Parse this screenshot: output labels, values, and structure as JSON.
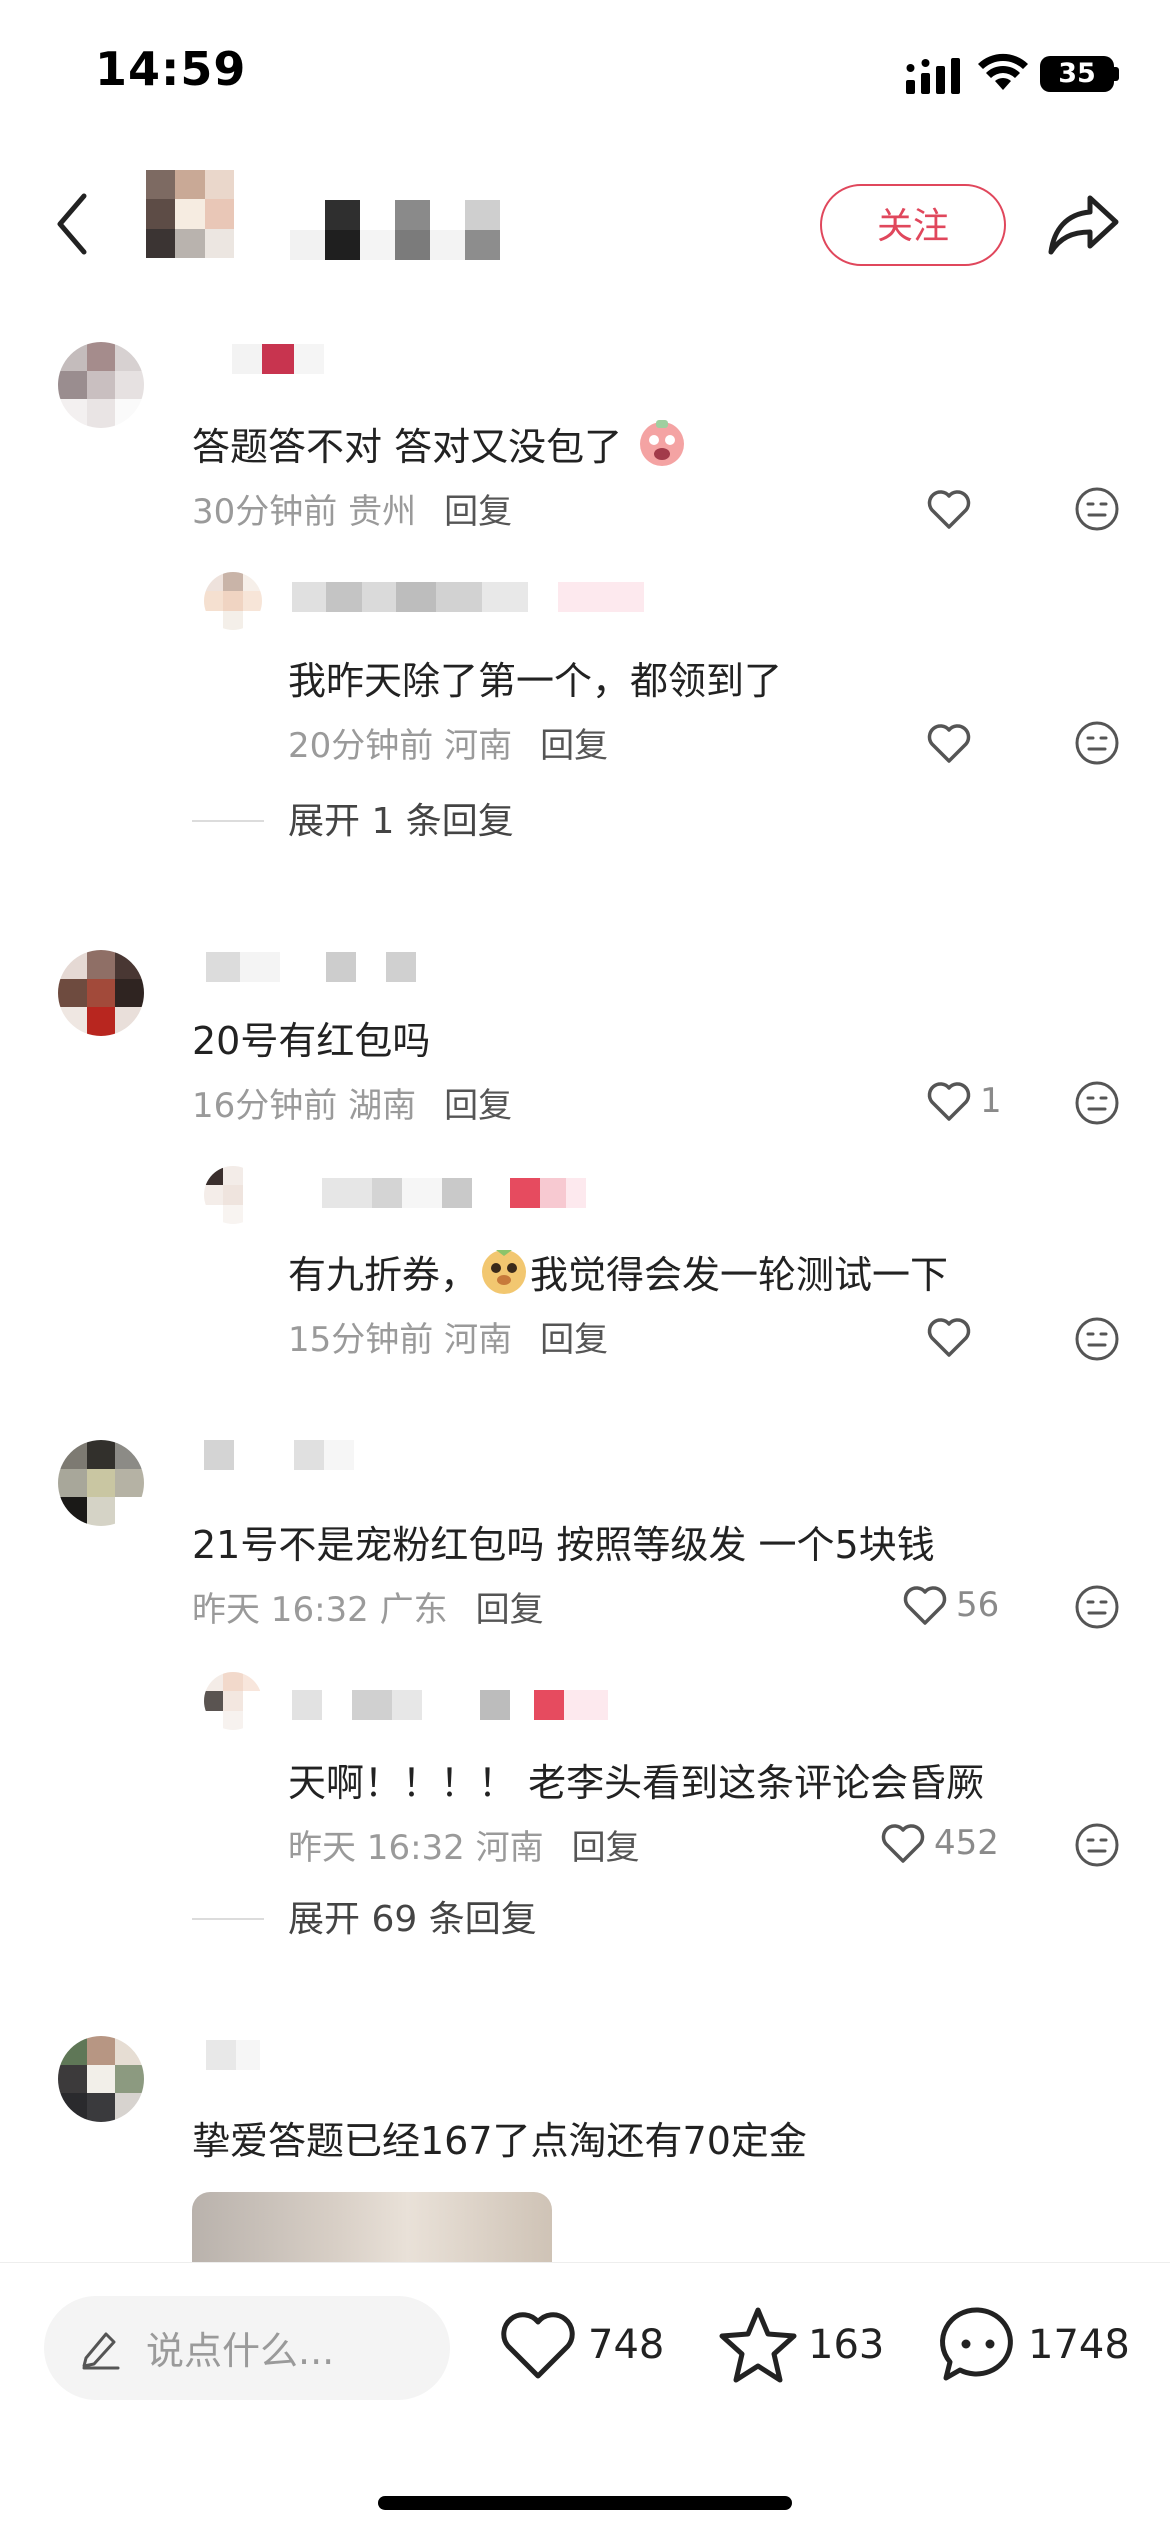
{
  "status_bar": {
    "time": "14:59",
    "battery": "35"
  },
  "header": {
    "follow_label": "关注"
  },
  "comments": [
    {
      "text": "答题答不对 答对又没包了",
      "time": "30分钟前",
      "location": "贵州",
      "reply_label": "回复",
      "likes": ""
    },
    {
      "text": "我昨天除了第一个，都领到了",
      "time": "20分钟前",
      "location": "河南",
      "reply_label": "回复",
      "likes": ""
    },
    {
      "text": "20号有红包吗",
      "time": "16分钟前",
      "location": "湖南",
      "reply_label": "回复",
      "likes": "1"
    },
    {
      "text_before": "有九折券，",
      "text_after": "我觉得会发一轮测试一下",
      "time": "15分钟前",
      "location": "河南",
      "reply_label": "回复",
      "likes": ""
    },
    {
      "text": "21号不是宠粉红包吗 按照等级发 一个5块钱",
      "time": "昨天 16:32",
      "location": "广东",
      "reply_label": "回复",
      "likes": "56"
    },
    {
      "text": "天啊！！！！ 老李头看到这条评论会昏厥",
      "time": "昨天 16:32",
      "location": "河南",
      "reply_label": "回复",
      "likes": "452"
    },
    {
      "text": "挚爱答题已经167了点淘还有70定金"
    }
  ],
  "expand_replies": [
    "展开 1 条回复",
    "展开 69 条回复"
  ],
  "bottom_bar": {
    "input_placeholder": "说点什么...",
    "likes": "748",
    "stars": "163",
    "comments": "1748"
  },
  "colors": {
    "accent": "#e0475c",
    "meta": "#9a9a9a"
  },
  "icons": [
    "back-icon",
    "share-icon",
    "heart-icon",
    "meh-face-icon",
    "pencil-icon",
    "star-icon",
    "chat-icon"
  ]
}
